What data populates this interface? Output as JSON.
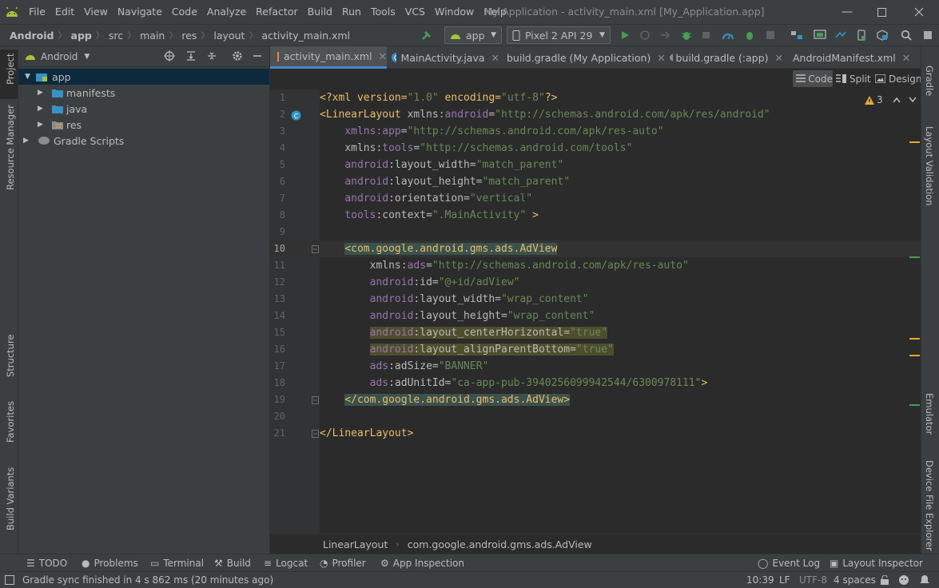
{
  "menubar": {
    "items": [
      "File",
      "Edit",
      "View",
      "Navigate",
      "Code",
      "Analyze",
      "Refactor",
      "Build",
      "Run",
      "Tools",
      "VCS",
      "Window",
      "Help"
    ],
    "window_title": "My Application - activity_main.xml [My_Application.app]"
  },
  "navbar": {
    "breadcrumb": [
      "Android",
      "app",
      "src",
      "main",
      "res",
      "layout",
      "activity_main.xml"
    ],
    "run_config": "app",
    "device": "Pixel 2 API 29"
  },
  "left_stripe": [
    "Project",
    "Resource Manager",
    "Structure",
    "Favorites",
    "Build Variants"
  ],
  "right_stripe": [
    "Gradle",
    "Layout Validation",
    "Emulator",
    "Device File Explorer"
  ],
  "project": {
    "view_mode": "Android",
    "tree": [
      {
        "label": "app",
        "kind": "module"
      },
      {
        "label": "manifests",
        "kind": "folder"
      },
      {
        "label": "java",
        "kind": "folder"
      },
      {
        "label": "res",
        "kind": "res-folder"
      },
      {
        "label": "Gradle Scripts",
        "kind": "gradle"
      }
    ]
  },
  "tabs": [
    {
      "label": "activity_main.xml",
      "icon": "xml-icon",
      "active": true
    },
    {
      "label": "MainActivity.java",
      "icon": "class-icon",
      "active": false
    },
    {
      "label": "build.gradle (My Application)",
      "icon": "gradle-icon",
      "active": false
    },
    {
      "label": "build.gradle (:app)",
      "icon": "gradle-icon",
      "active": false
    },
    {
      "label": "AndroidManifest.xml",
      "icon": "manifest-icon",
      "active": false
    }
  ],
  "view_modes": {
    "code": "Code",
    "split": "Split",
    "design": "Design"
  },
  "inspections": {
    "warnings": "3"
  },
  "code_lines": [
    {
      "n": "1",
      "segs": [
        [
          "pi",
          "<?xml version="
        ],
        [
          "val",
          "\"1.0\""
        ],
        [
          "pi",
          " encoding="
        ],
        [
          "val",
          "\"utf-8\""
        ],
        [
          "pi",
          "?>"
        ]
      ]
    },
    {
      "n": "2",
      "segs": [
        [
          "tag",
          "<LinearLayout "
        ],
        [
          "attr",
          "xmlns:"
        ],
        [
          "ns",
          "android"
        ],
        [
          "attr",
          "="
        ],
        [
          "val",
          "\"http://schemas.android.com/apk/res/android\""
        ]
      ]
    },
    {
      "n": "3",
      "segs": [
        [
          "ind",
          "    "
        ],
        [
          "ns",
          "xmlns:app"
        ],
        [
          "attr",
          "="
        ],
        [
          "val",
          "\"http://schemas.android.com/apk/res-auto\""
        ]
      ]
    },
    {
      "n": "4",
      "segs": [
        [
          "ind",
          "    "
        ],
        [
          "attr",
          "xmlns:"
        ],
        [
          "ns",
          "tools"
        ],
        [
          "attr",
          "="
        ],
        [
          "val",
          "\"http://schemas.android.com/tools\""
        ]
      ]
    },
    {
      "n": "5",
      "segs": [
        [
          "ind",
          "    "
        ],
        [
          "ns",
          "android"
        ],
        [
          "attr",
          ":layout_width="
        ],
        [
          "val",
          "\"match_parent\""
        ]
      ]
    },
    {
      "n": "6",
      "segs": [
        [
          "ind",
          "    "
        ],
        [
          "ns",
          "android"
        ],
        [
          "attr",
          ":layout_height="
        ],
        [
          "val",
          "\"match_parent\""
        ]
      ]
    },
    {
      "n": "7",
      "segs": [
        [
          "ind",
          "    "
        ],
        [
          "ns",
          "android"
        ],
        [
          "attr",
          ":orientation="
        ],
        [
          "val",
          "\"vertical\""
        ]
      ]
    },
    {
      "n": "8",
      "segs": [
        [
          "ind",
          "    "
        ],
        [
          "ns",
          "tools"
        ],
        [
          "attr",
          ":context="
        ],
        [
          "val",
          "\".MainActivity\""
        ],
        [
          "tag",
          " >"
        ]
      ]
    },
    {
      "n": "9",
      "segs": []
    },
    {
      "n": "10",
      "segs": [
        [
          "ind",
          "    "
        ],
        [
          "tagh",
          "<com.google.android.gms.ads.AdView"
        ]
      ]
    },
    {
      "n": "11",
      "segs": [
        [
          "ind",
          "        "
        ],
        [
          "attr",
          "xmlns:"
        ],
        [
          "ns",
          "ads"
        ],
        [
          "attr",
          "="
        ],
        [
          "val",
          "\"http://schemas.android.com/apk/res-auto\""
        ]
      ]
    },
    {
      "n": "12",
      "segs": [
        [
          "ind",
          "        "
        ],
        [
          "ns",
          "android"
        ],
        [
          "attr",
          ":id="
        ],
        [
          "val",
          "\"@+id/adView\""
        ]
      ]
    },
    {
      "n": "13",
      "segs": [
        [
          "ind",
          "        "
        ],
        [
          "ns",
          "android"
        ],
        [
          "attr",
          ":layout_width="
        ],
        [
          "val",
          "\"wrap_content\""
        ]
      ]
    },
    {
      "n": "14",
      "segs": [
        [
          "ind",
          "        "
        ],
        [
          "ns",
          "android"
        ],
        [
          "attr",
          ":layout_height="
        ],
        [
          "val",
          "\"wrap_content\""
        ]
      ]
    },
    {
      "n": "15",
      "segs": [
        [
          "ind",
          "        "
        ],
        [
          "hns",
          "android"
        ],
        [
          "hattr",
          ":layout_centerHorizontal="
        ],
        [
          "hval",
          "\"true\""
        ]
      ]
    },
    {
      "n": "16",
      "segs": [
        [
          "ind",
          "        "
        ],
        [
          "hns",
          "android"
        ],
        [
          "hattr",
          ":layout_alignParentBottom="
        ],
        [
          "hval",
          "\"true\""
        ]
      ]
    },
    {
      "n": "17",
      "segs": [
        [
          "ind",
          "        "
        ],
        [
          "ns",
          "ads"
        ],
        [
          "attr",
          ":adSize="
        ],
        [
          "val",
          "\"BANNER\""
        ]
      ]
    },
    {
      "n": "18",
      "segs": [
        [
          "ind",
          "        "
        ],
        [
          "ns",
          "ads"
        ],
        [
          "attr",
          ":adUnitId="
        ],
        [
          "val",
          "\"ca-app-pub-3940256099942544/6300978111\""
        ],
        [
          "tag",
          ">"
        ]
      ]
    },
    {
      "n": "19",
      "segs": [
        [
          "ind",
          "    "
        ],
        [
          "tagh",
          "</com.google.android.gms.ads.AdView>"
        ]
      ]
    },
    {
      "n": "20",
      "segs": []
    },
    {
      "n": "21",
      "segs": [
        [
          "tag",
          "</LinearLayout>"
        ]
      ]
    }
  ],
  "editor_breadcrumb": [
    "LinearLayout",
    "com.google.android.gms.ads.AdView"
  ],
  "bottom_tabs": [
    {
      "label": "TODO",
      "icon": "list-icon"
    },
    {
      "label": "Problems",
      "icon": "info-icon"
    },
    {
      "label": "Terminal",
      "icon": "terminal-icon"
    },
    {
      "label": "Build",
      "icon": "hammer-icon"
    },
    {
      "label": "Logcat",
      "icon": "logcat-icon"
    },
    {
      "label": "Profiler",
      "icon": "profiler-icon"
    },
    {
      "label": "App Inspection",
      "icon": "inspection-icon"
    }
  ],
  "bottom_tabs_right": [
    {
      "label": "Event Log",
      "icon": "event-log-icon"
    },
    {
      "label": "Layout Inspector",
      "icon": "layout-inspector-icon"
    }
  ],
  "status": {
    "message": "Gradle sync finished in 4 s 862 ms (20 minutes ago)",
    "position": "10:39",
    "line_sep": "LF",
    "encoding": "UTF-8",
    "indent": "4 spaces"
  },
  "colors": {
    "accent": "#4a88c7",
    "run_green": "#499c54",
    "android_green": "#a4c639",
    "warning": "#e0ac36"
  }
}
